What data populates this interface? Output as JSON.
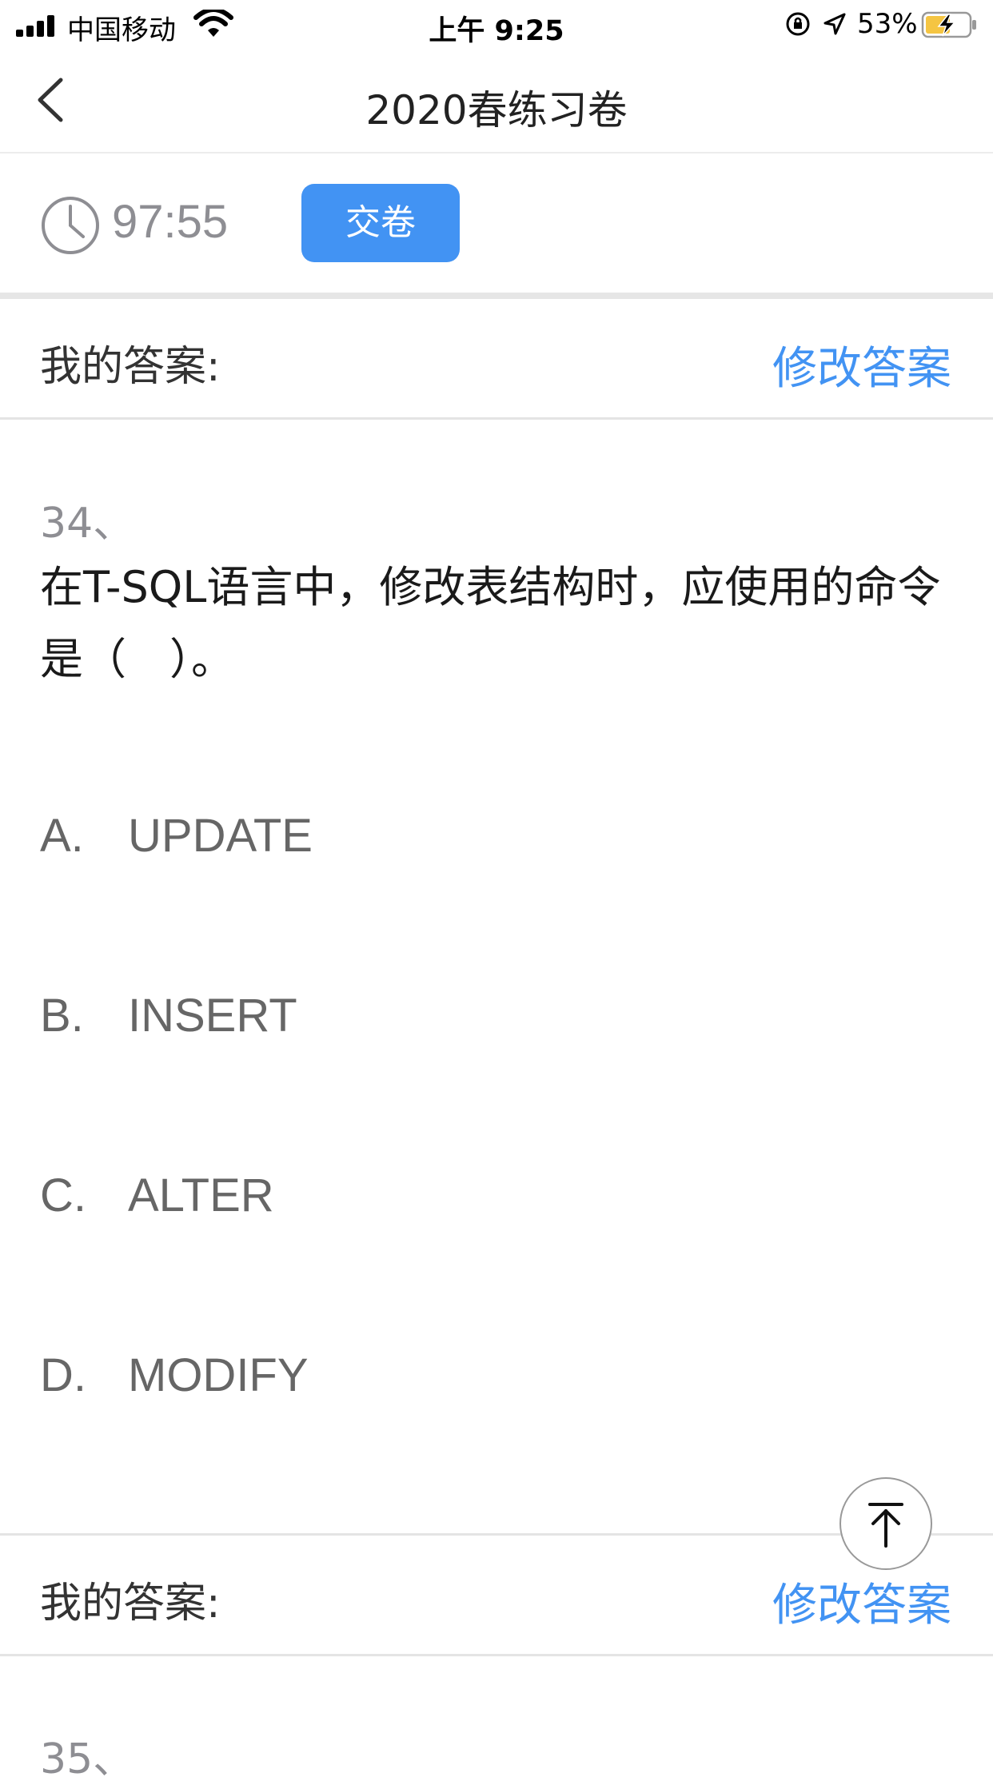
{
  "status_bar": {
    "carrier": "中国移动",
    "time": "上午 9:25",
    "battery_pct": "53%",
    "icons": [
      "signal-icon",
      "wifi-icon",
      "orientation-lock-icon",
      "location-arrow-icon",
      "battery-charging-icon"
    ]
  },
  "nav": {
    "title": "2020春练习卷",
    "back_icon": "chevron-left-icon"
  },
  "timer": {
    "icon": "clock-icon",
    "value": "97:55",
    "submit_label": "交卷"
  },
  "answer_bar": {
    "label": "我的答案:",
    "modify_label": "修改答案"
  },
  "question": {
    "number": "34、",
    "text": " 在T-SQL语言中，修改表结构时，应使用的命令是（　）。",
    "options": [
      {
        "letter": "A.",
        "text": "UPDATE"
      },
      {
        "letter": "B.",
        "text": "INSERT"
      },
      {
        "letter": "C.",
        "text": "ALTER"
      },
      {
        "letter": "D.",
        "text": "MODIFY"
      }
    ]
  },
  "answer_bar_2": {
    "label": "我的答案:",
    "modify_label": "修改答案"
  },
  "next_question": {
    "number": "35、"
  },
  "scroll_top_icon": "arrow-to-top-icon",
  "colors": {
    "accent": "#4293f3",
    "muted": "#8e8e93"
  }
}
